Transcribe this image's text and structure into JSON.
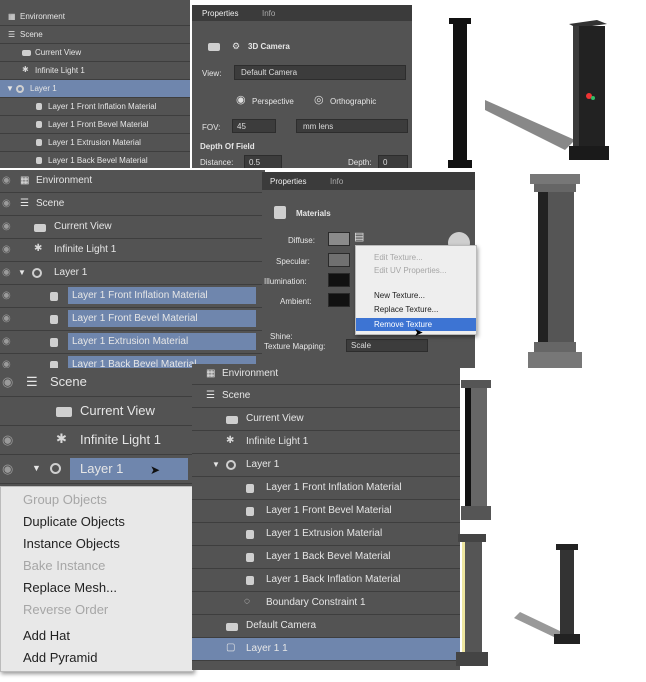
{
  "panel1": {
    "layers": [
      {
        "label": "Environment"
      },
      {
        "label": "Scene"
      },
      {
        "label": "Current View"
      },
      {
        "label": "Infinite Light 1"
      },
      {
        "label": "Layer 1"
      },
      {
        "label": "Layer 1 Front Inflation Material"
      },
      {
        "label": "Layer 1 Front Bevel Material"
      },
      {
        "label": "Layer 1 Extrusion Material"
      },
      {
        "label": "Layer 1 Back Bevel Material"
      }
    ]
  },
  "props1": {
    "tab_properties": "Properties",
    "tab_info": "Info",
    "title": "3D Camera",
    "view_label": "View:",
    "view_value": "Default Camera",
    "perspective": "Perspective",
    "orthographic": "Orthographic",
    "fov_label": "FOV:",
    "fov_value": "45",
    "lens_value": "mm lens",
    "dof_heading": "Depth Of Field",
    "distance_label": "Distance:",
    "distance_value": "0.5",
    "depth_label": "Depth:",
    "depth_value": "0"
  },
  "panel2": {
    "layers": [
      {
        "label": "Environment"
      },
      {
        "label": "Scene"
      },
      {
        "label": "Current View"
      },
      {
        "label": "Infinite Light 1"
      },
      {
        "label": "Layer 1"
      },
      {
        "label": "Layer 1 Front Inflation Material"
      },
      {
        "label": "Layer 1 Front Bevel Material"
      },
      {
        "label": "Layer 1 Extrusion Material"
      },
      {
        "label": "Layer 1 Back Bevel Material"
      }
    ]
  },
  "props2": {
    "tab_properties": "Properties",
    "tab_info": "Info",
    "title": "Materials",
    "diffuse": "Diffuse:",
    "specular": "Specular:",
    "illumination": "Illumination:",
    "ambient": "Ambient:",
    "shine": "Shine:",
    "texture_mapping": "Texture Mapping:",
    "mapping_value": "Scale"
  },
  "texture_menu": {
    "items": [
      {
        "label": "Edit Texture...",
        "state": "disabled"
      },
      {
        "label": "Edit UV Properties...",
        "state": "disabled"
      },
      {
        "label": "New Texture...",
        "state": "normal"
      },
      {
        "label": "Replace Texture...",
        "state": "normal"
      },
      {
        "label": "Remove Texture",
        "state": "highlighted"
      }
    ]
  },
  "panel3": {
    "layers": [
      {
        "label": "Scene"
      },
      {
        "label": "Current View"
      },
      {
        "label": "Infinite Light 1"
      },
      {
        "label": "Layer 1"
      }
    ]
  },
  "object_menu": {
    "items": [
      {
        "label": "Group Objects",
        "state": "disabled"
      },
      {
        "label": "Duplicate Objects",
        "state": "normal"
      },
      {
        "label": "Instance Objects",
        "state": "normal"
      },
      {
        "label": "Bake Instance",
        "state": "disabled"
      },
      {
        "label": "Replace Mesh...",
        "state": "normal"
      },
      {
        "label": "Reverse Order",
        "state": "disabled"
      },
      {
        "label": "Add Hat",
        "state": "normal"
      },
      {
        "label": "Add Pyramid",
        "state": "normal"
      }
    ]
  },
  "panel4": {
    "layers": [
      {
        "label": "Environment"
      },
      {
        "label": "Scene"
      },
      {
        "label": "Current View"
      },
      {
        "label": "Infinite Light 1"
      },
      {
        "label": "Layer 1"
      },
      {
        "label": "Layer 1 Front Inflation Material"
      },
      {
        "label": "Layer 1 Front Bevel Material"
      },
      {
        "label": "Layer 1 Extrusion Material"
      },
      {
        "label": "Layer 1 Back Bevel Material"
      },
      {
        "label": "Layer 1 Back Inflation Material"
      },
      {
        "label": "Boundary Constraint 1"
      },
      {
        "label": "Default Camera"
      },
      {
        "label": "Layer 1 1"
      }
    ]
  },
  "colors": {
    "panel_bg": "#535353",
    "selection": "#6f86ad",
    "menu_highlight": "#3d74d3"
  }
}
